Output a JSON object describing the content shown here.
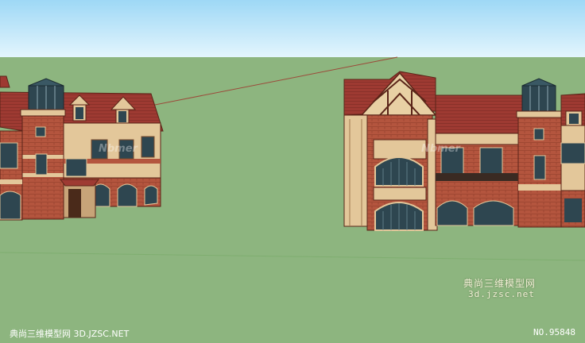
{
  "watermark": {
    "chinese": "典尚三维模型网",
    "url": "3d.jzsc.net",
    "ghost_left": "Nbmer",
    "ghost_right": "Nbmer"
  },
  "footer": {
    "left_text": "典尚三维模型网 3D.JZSC.NET",
    "right_text": "NO.95848"
  },
  "colors": {
    "sky": "#bfe8fb",
    "ground": "#8db57f",
    "brick": "#b4553e",
    "roof": "#9e3a32",
    "trim": "#e3c79a",
    "glass": "#2e4650"
  }
}
